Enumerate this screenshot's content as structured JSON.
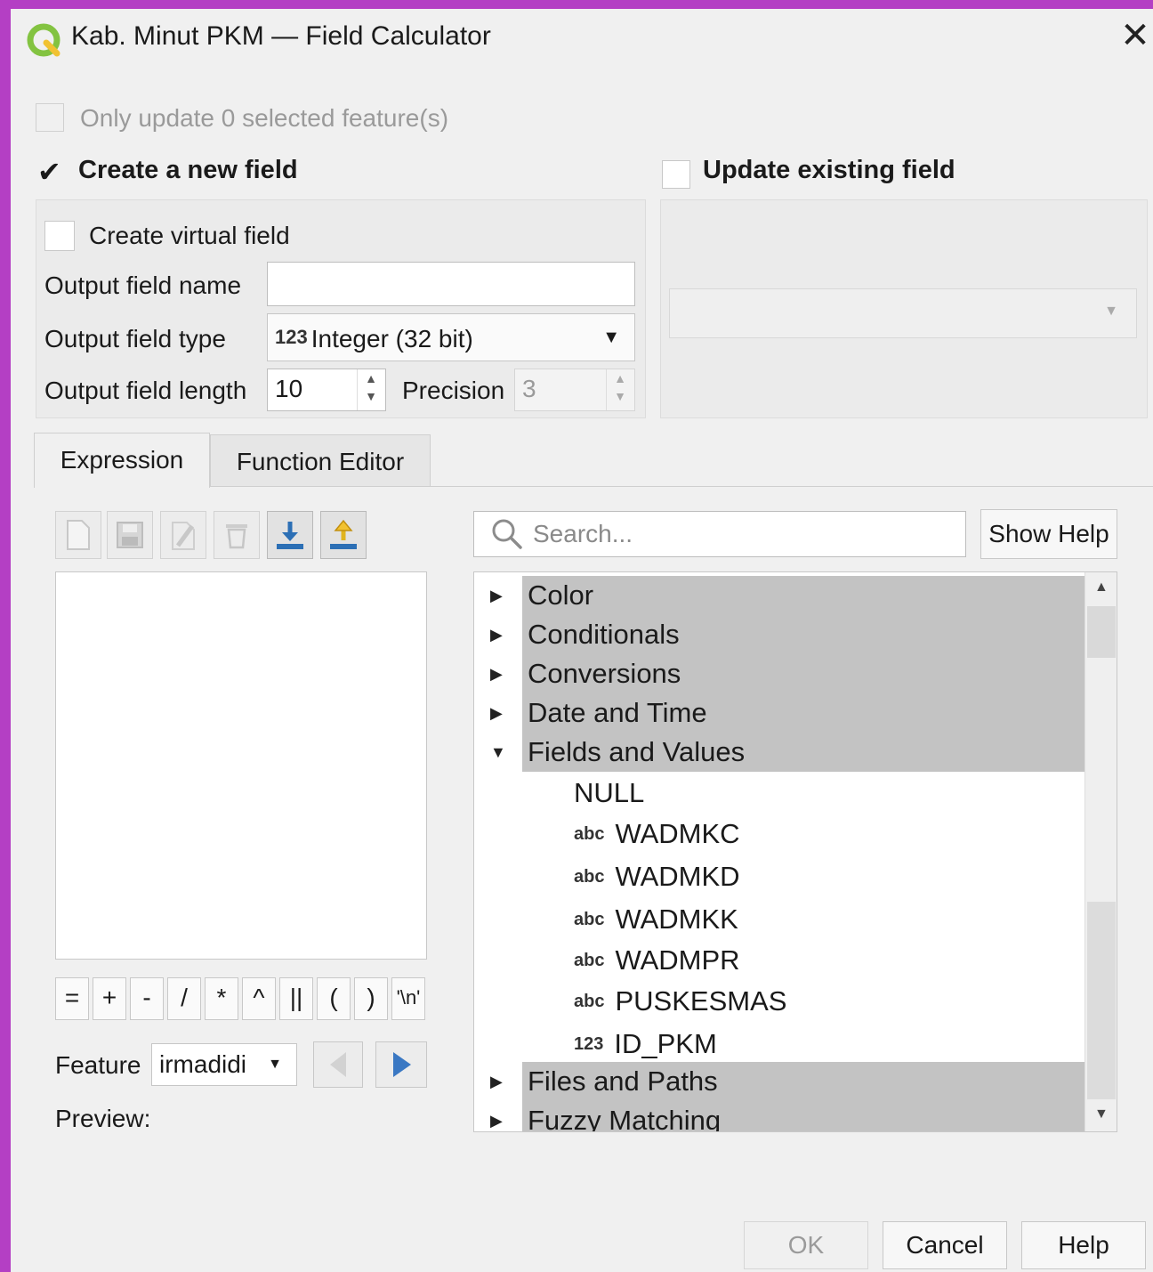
{
  "window": {
    "title": "Kab. Minut PKM — Field Calculator",
    "close_glyph": "✕",
    "icon": "qgis-logo-icon"
  },
  "options": {
    "only_selected_label": "Only update 0 selected feature(s)",
    "create_new_field": {
      "label": "Create a new field",
      "checked": true,
      "check_glyph": "✔"
    },
    "update_existing": {
      "label": "Update existing field",
      "checked": false
    }
  },
  "new_field": {
    "virtual_label": "Create virtual field",
    "name_label": "Output field name",
    "name_value": "",
    "type_label": "Output field type",
    "type_prefix": "123",
    "type_value": "Integer (32 bit)",
    "length_label": "Output field length",
    "length_value": "10",
    "precision_label": "Precision",
    "precision_value": "3"
  },
  "tabs": [
    {
      "label": "Expression",
      "active": true
    },
    {
      "label": "Function Editor",
      "active": false
    }
  ],
  "operators": [
    "=",
    "+",
    "-",
    "/",
    "*",
    "^",
    "||",
    "(",
    ")",
    "'\\n'"
  ],
  "feature": {
    "label": "Feature",
    "value": "irmadidi",
    "preview_label": "Preview:"
  },
  "search": {
    "placeholder": "Search..."
  },
  "show_help_label": "Show Help",
  "tree": {
    "groups_top": [
      "Color",
      "Conditionals",
      "Conversions",
      "Date and Time"
    ],
    "expanded_group": "Fields and Values",
    "null_item": "NULL",
    "fields": [
      {
        "type": "abc",
        "name": "WADMKC"
      },
      {
        "type": "abc",
        "name": "WADMKD"
      },
      {
        "type": "abc",
        "name": "WADMKK"
      },
      {
        "type": "abc",
        "name": "WADMPR"
      },
      {
        "type": "abc",
        "name": "PUSKESMAS"
      },
      {
        "type": "123",
        "name": "ID_PKM"
      }
    ],
    "groups_bottom": [
      "Files and Paths",
      "Fuzzy Matching"
    ]
  },
  "buttons": {
    "ok": "OK",
    "cancel": "Cancel",
    "help": "Help"
  },
  "colors": {
    "accent_blue": "#3a78c3",
    "group_highlight": "#c3c3c3",
    "window_border": "#b43fc4"
  }
}
